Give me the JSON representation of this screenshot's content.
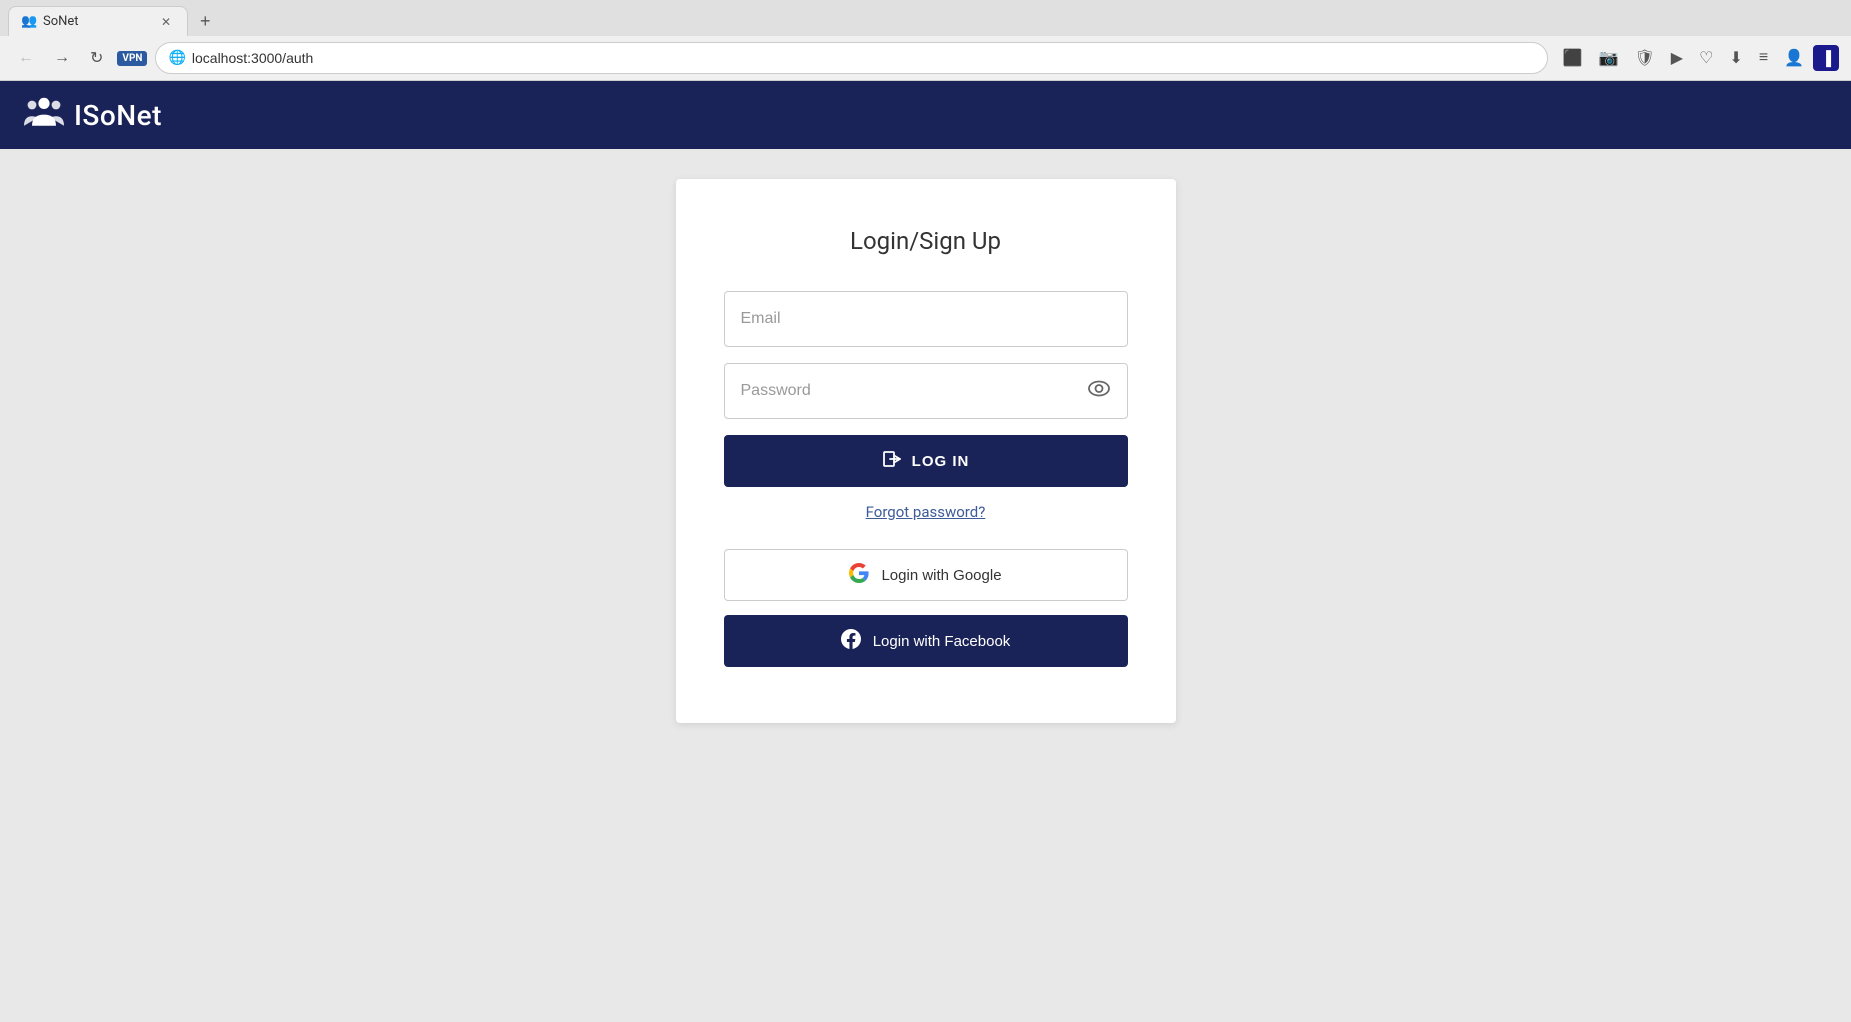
{
  "browser": {
    "tab": {
      "title": "SoNet",
      "favicon": "👥",
      "new_tab_label": "+"
    },
    "nav": {
      "back_label": "←",
      "forward_label": "→",
      "refresh_label": "↻",
      "vpn_label": "VPN",
      "address": "localhost:3000/auth"
    }
  },
  "app": {
    "logo_text": "ISoNet",
    "header_title": "ISoNet"
  },
  "page": {
    "title": "Login/Sign Up",
    "email_placeholder": "Email",
    "password_placeholder": "Password",
    "login_button_label": "LOG IN",
    "forgot_password_label": "Forgot password?",
    "google_button_label": "Login with Google",
    "facebook_button_label": "Login with Facebook"
  }
}
